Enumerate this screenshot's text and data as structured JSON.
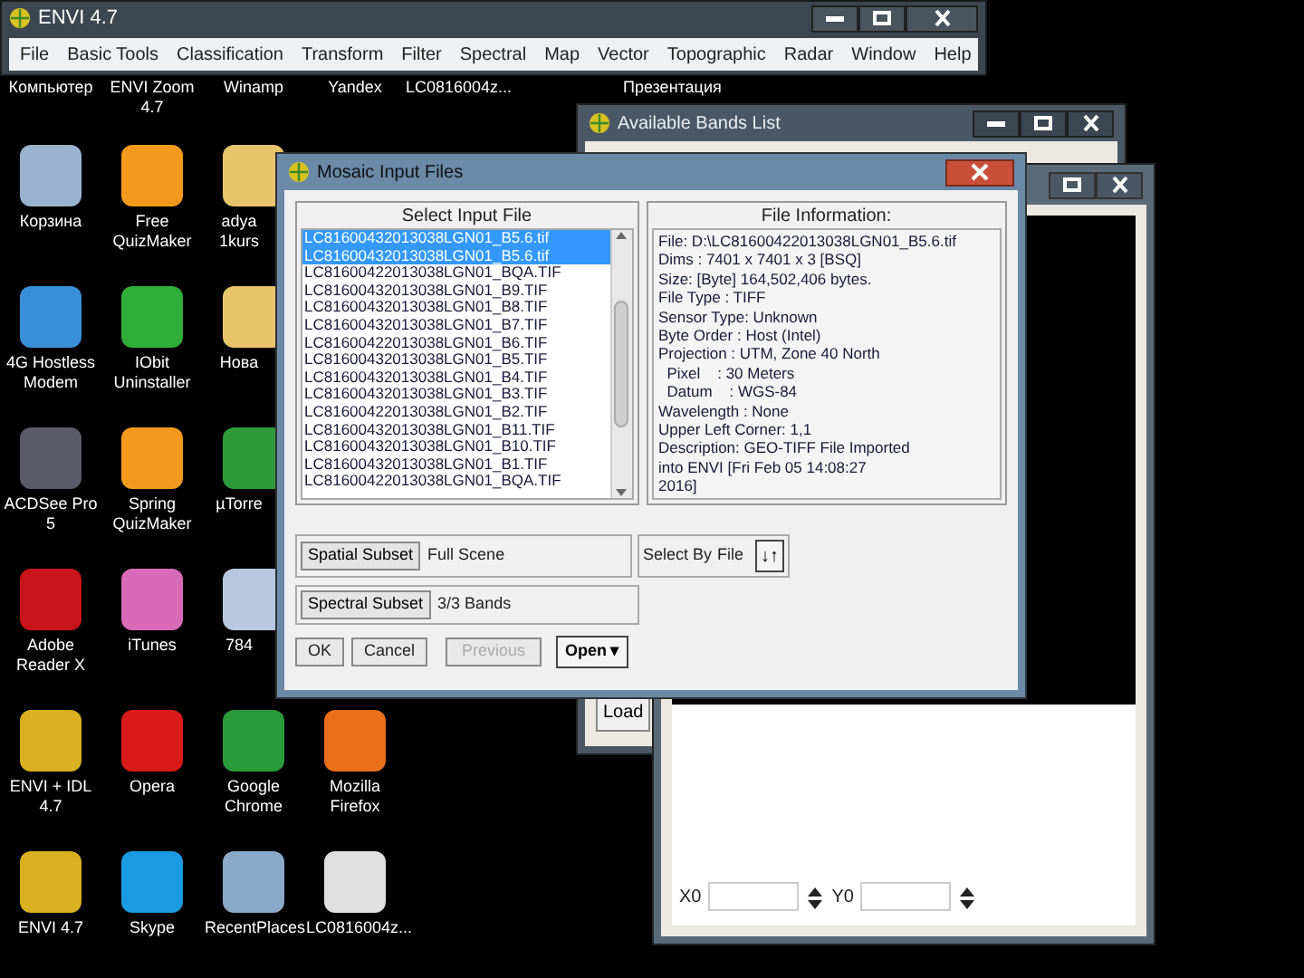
{
  "main_window": {
    "title": "ENVI 4.7",
    "menu": [
      "File",
      "Basic Tools",
      "Classification",
      "Transform",
      "Filter",
      "Spectral",
      "Map",
      "Vector",
      "Topographic",
      "Radar",
      "Window",
      "Help"
    ]
  },
  "desktop": {
    "top_labels": [
      "Компьютер",
      "ENVI Zoom 4.7",
      "Winamp",
      "Yandex",
      "LC0816004z...",
      "Презентация"
    ],
    "rows": [
      [
        {
          "label": "Корзина",
          "color": "#9ab4d0"
        },
        {
          "label": "Free QuizMaker",
          "color": "#f39a1e"
        },
        {
          "label": "adya 1kurs",
          "color": "#e8c46a"
        }
      ],
      [
        {
          "label": "4G Hostless Modem",
          "color": "#3a8fd8"
        },
        {
          "label": "IObit Uninstaller",
          "color": "#2fae3a"
        },
        {
          "label": "Нова",
          "color": "#e8c46a"
        }
      ],
      [
        {
          "label": "ACDSee Pro 5",
          "color": "#5a5a6a"
        },
        {
          "label": "Spring QuizMaker",
          "color": "#f39a1e"
        },
        {
          "label": "µTorre",
          "color": "#2f9a3a"
        }
      ],
      [
        {
          "label": "Adobe Reader X",
          "color": "#c8141a"
        },
        {
          "label": "iTunes",
          "color": "#d86ab8"
        },
        {
          "label": "784",
          "color": "#b8c8e0"
        }
      ],
      [
        {
          "label": "ENVI + IDL 4.7",
          "color": "#d8b020"
        },
        {
          "label": "Opera",
          "color": "#d81a1a"
        },
        {
          "label": "Google Chrome",
          "color": "#2a9a3a"
        },
        {
          "label": "Mozilla Firefox",
          "color": "#e8701a"
        }
      ],
      [
        {
          "label": "ENVI 4.7",
          "color": "#d8b020"
        },
        {
          "label": "Skype",
          "color": "#1a9ae0"
        },
        {
          "label": "RecentPlaces",
          "color": "#8aa8c8"
        },
        {
          "label": "LC0816004z...",
          "color": "#e0e0e0"
        }
      ]
    ]
  },
  "bands_window": {
    "title": "Available Bands List",
    "button": "Load"
  },
  "display_window": {
    "x_label": "X0",
    "y_label": "Y0"
  },
  "dialog": {
    "title": "Mosaic Input Files",
    "list_header": "Select Input File",
    "files": [
      {
        "name": "LC81600432013038LGN01_B5.6.tif",
        "selected": true
      },
      {
        "name": "LC81600432013038LGN01_B5.6.tif",
        "selected": true
      },
      {
        "name": "LC81600422013038LGN01_BQA.TIF",
        "selected": false
      },
      {
        "name": "LC81600432013038LGN01_B9.TIF",
        "selected": false
      },
      {
        "name": "LC81600432013038LGN01_B8.TIF",
        "selected": false
      },
      {
        "name": "LC81600432013038LGN01_B7.TIF",
        "selected": false
      },
      {
        "name": "LC81600422013038LGN01_B6.TIF",
        "selected": false
      },
      {
        "name": "LC81600432013038LGN01_B5.TIF",
        "selected": false
      },
      {
        "name": "LC81600432013038LGN01_B4.TIF",
        "selected": false
      },
      {
        "name": "LC81600432013038LGN01_B3.TIF",
        "selected": false
      },
      {
        "name": "LC81600422013038LGN01_B2.TIF",
        "selected": false
      },
      {
        "name": "LC81600432013038LGN01_B11.TIF",
        "selected": false
      },
      {
        "name": "LC81600432013038LGN01_B10.TIF",
        "selected": false
      },
      {
        "name": "LC81600432013038LGN01_B1.TIF",
        "selected": false
      },
      {
        "name": "LC81600422013038LGN01_BQA.TIF",
        "selected": false
      }
    ],
    "info_header": "File Information:",
    "info_lines": [
      "File: D:\\LC81600422013038LGN01_B5.6.tif",
      "Dims : 7401 x 7401 x 3 [BSQ]",
      "Size: [Byte] 164,502,406 bytes.",
      "File Type : TIFF",
      "Sensor Type: Unknown",
      "Byte Order : Host (Intel)",
      "Projection : UTM, Zone 40 North",
      "  Pixel    : 30 Meters",
      "  Datum    : WGS-84",
      "Wavelength : None",
      "Upper Left Corner: 1,1",
      "Description: GEO-TIFF File Imported",
      "into ENVI [Fri Feb 05 14:08:27",
      "2016]"
    ],
    "spatial_button": "Spatial Subset",
    "spatial_value": "Full Scene",
    "select_by_label": "Select By",
    "select_by_value": "File",
    "sort_button": "↓↑",
    "spectral_button": "Spectral Subset",
    "spectral_value": "3/3 Bands",
    "buttons": [
      {
        "label": "OK",
        "disabled": false
      },
      {
        "label": "Cancel",
        "disabled": false
      },
      {
        "label": "Previous",
        "disabled": true
      }
    ],
    "open_button": "Open",
    "open_caret": "▾"
  }
}
